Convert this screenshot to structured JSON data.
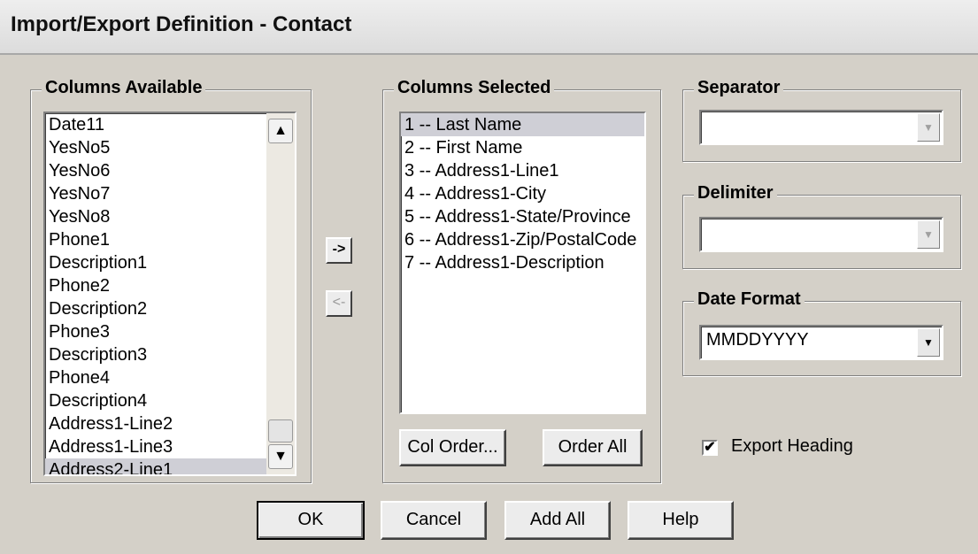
{
  "window": {
    "title": "Import/Export Definition - Contact"
  },
  "columns_available": {
    "label": "Columns Available",
    "items": [
      "Date11",
      "YesNo5",
      "YesNo6",
      "YesNo7",
      "YesNo8",
      "Phone1",
      "Description1",
      "Phone2",
      "Description2",
      "Phone3",
      "Description3",
      "Phone4",
      "Description4",
      "Address1-Line2",
      "Address1-Line3",
      "Address2-Line1"
    ],
    "selected_index": 15
  },
  "move_buttons": {
    "add_label": "->",
    "remove_label": "<-"
  },
  "columns_selected": {
    "label": "Columns Selected",
    "items": [
      "1 -- Last Name",
      "2 -- First Name",
      "3 -- Address1-Line1",
      "4 -- Address1-City",
      "5 -- Address1-State/Province",
      "6 -- Address1-Zip/PostalCode",
      "7 -- Address1-Description"
    ],
    "selected_index": 0,
    "col_order_label": "Col Order...",
    "order_all_label": "Order All"
  },
  "separator": {
    "label": "Separator",
    "value": ""
  },
  "delimiter": {
    "label": "Delimiter",
    "value": ""
  },
  "date_format": {
    "label": "Date Format",
    "value": "MMDDYYYY"
  },
  "export_heading": {
    "label": "Export Heading",
    "checked": true
  },
  "footer": {
    "ok_label": "OK",
    "cancel_label": "Cancel",
    "add_all_label": "Add All",
    "help_label": "Help"
  },
  "icons": {
    "scroll_up": "chevron-up-icon",
    "scroll_down": "chevron-down-icon",
    "dropdown": "triangle-down-icon",
    "check": "checkmark-icon"
  }
}
